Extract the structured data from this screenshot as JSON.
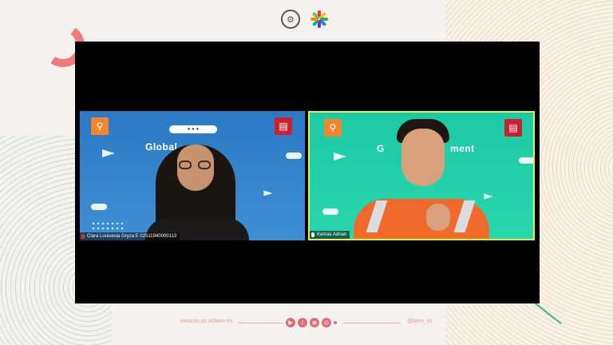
{
  "colors": {
    "background": "#f4f1ee",
    "stage": "#000000",
    "active_speaker_border": "#e1f04b",
    "accent_pink": "#e06e76"
  },
  "header": {
    "logos": [
      {
        "name": "its-seal-logo",
        "glyph": "⚙"
      },
      {
        "name": "colorful-burst-logo",
        "glyph": ""
      }
    ]
  },
  "meeting": {
    "participants": [
      {
        "name": "Clara Louisesia Gryza E 02511940000113",
        "muted": true,
        "background_title": "Global",
        "sdg_left_icon": "person-icon",
        "sdg_right_icon": "book-icon",
        "active_speaker": false
      },
      {
        "name": "Kemas Adrian",
        "muted": false,
        "background_title": "G",
        "background_title_tail": "ment",
        "sdg_left_icon": "person-icon",
        "sdg_right_icon": "book-icon",
        "active_speaker": true
      }
    ]
  },
  "footer": {
    "url": "www.its.ac.id/bem-its",
    "handle": "@bem_its",
    "social_icons": [
      {
        "name": "youtube-icon",
        "glyph": "▶"
      },
      {
        "name": "twitter-icon",
        "glyph": "t"
      },
      {
        "name": "line-icon",
        "glyph": "◉"
      },
      {
        "name": "instagram-icon",
        "glyph": "◎"
      }
    ]
  }
}
